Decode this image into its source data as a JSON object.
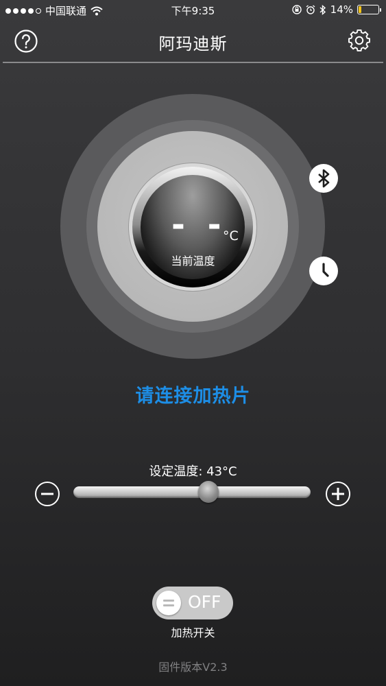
{
  "status_bar": {
    "carrier": "中国联通",
    "time": "下午9:35",
    "battery_percent": "14%",
    "battery_level": 0.14,
    "signal_bars": 4,
    "signal_total": 5
  },
  "nav": {
    "title": "阿玛迪斯",
    "help_icon": "help-circle-icon",
    "settings_icon": "gear-icon"
  },
  "dial": {
    "current_temp": "- -",
    "unit": "°C",
    "label": "当前温度",
    "bluetooth_icon": "bluetooth-icon",
    "timer_icon": "clock-icon"
  },
  "prompt": "请连接加热片",
  "setting": {
    "label": "设定温度: 43°C",
    "slider_position": 0.57
  },
  "heater": {
    "state": "OFF",
    "label": "加热开关"
  },
  "firmware": "固件版本V2.3",
  "colors": {
    "accent": "#1d8ee6",
    "battery_low": "#f3c318",
    "background_top": "#3a3a3c",
    "background_bottom": "#1f1f20"
  }
}
